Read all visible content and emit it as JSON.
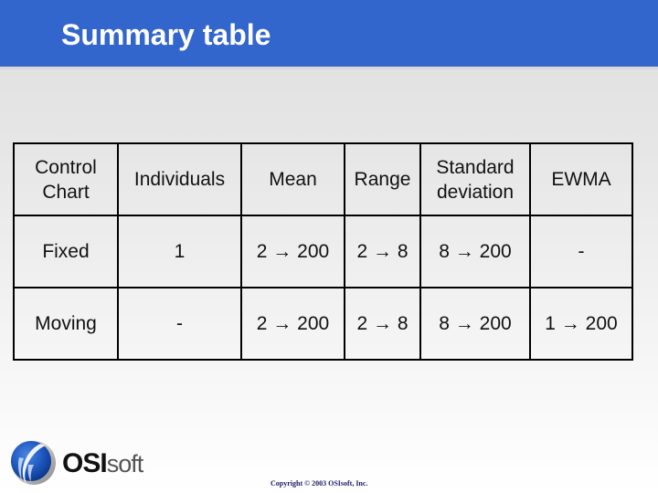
{
  "slide": {
    "title": "Summary table",
    "colors": {
      "header_bar": "#3366cc",
      "title_text": "#ffffff",
      "copyright_text": "#1a1a66"
    }
  },
  "table": {
    "headers": [
      "Control\nChart",
      "Individuals",
      "Mean",
      "Range",
      "Standard\ndeviation",
      "EWMA"
    ],
    "header_lines": [
      [
        "Control",
        "Chart"
      ],
      [
        "Individuals"
      ],
      [
        "Mean"
      ],
      [
        "Range"
      ],
      [
        "Standard",
        "deviation"
      ],
      [
        "EWMA"
      ]
    ],
    "rows": [
      [
        "Fixed",
        "1",
        "2 → 200",
        "2 → 8",
        "8 → 200",
        "-"
      ],
      [
        "Moving",
        "-",
        "2 → 200",
        "2 → 8",
        "8 → 200",
        "1 → 200"
      ]
    ]
  },
  "footer": {
    "logo": {
      "icon": "osisoft-globe-icon",
      "bold_text": "OSI",
      "light_text": "soft"
    },
    "copyright": "Copyright © 2003 OSIsoft, Inc."
  }
}
